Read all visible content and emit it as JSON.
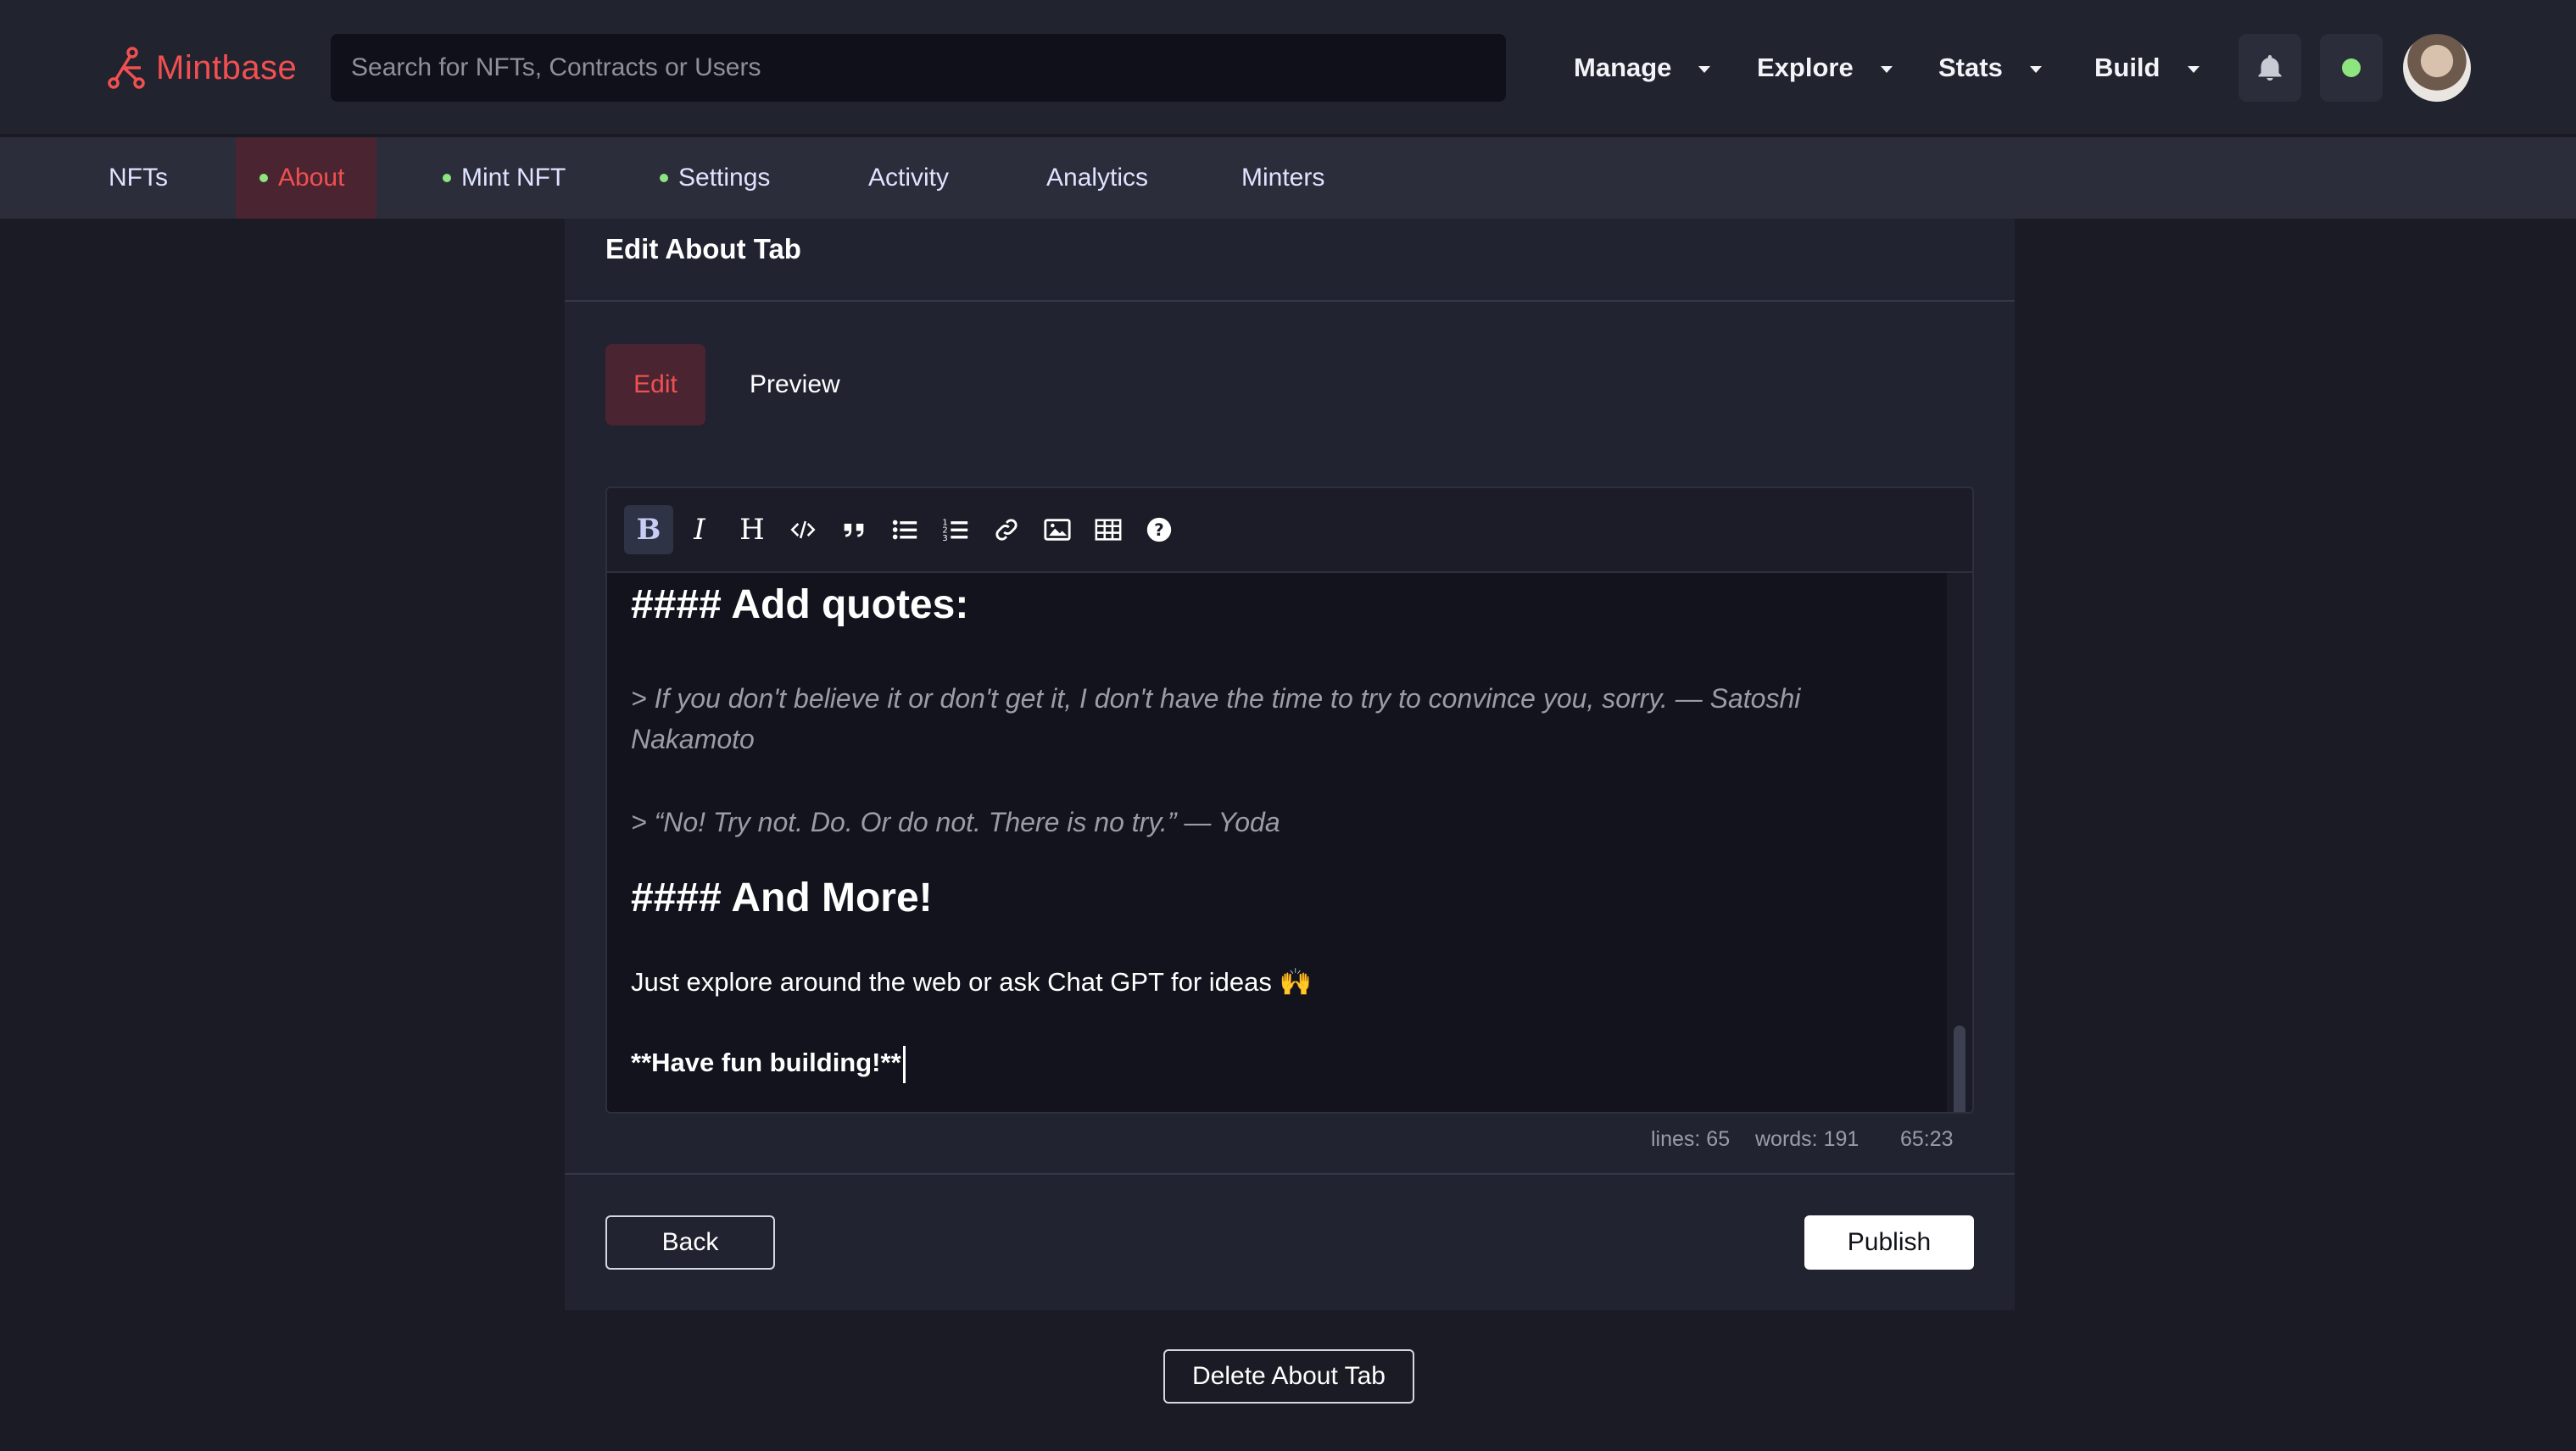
{
  "brand": {
    "name": "Mintbase",
    "color": "#f25050"
  },
  "search": {
    "placeholder": "Search for NFTs, Contracts or Users",
    "value": ""
  },
  "nav": {
    "menus": [
      {
        "label": "Manage"
      },
      {
        "label": "Explore"
      },
      {
        "label": "Stats"
      },
      {
        "label": "Build"
      }
    ],
    "icons": {
      "notifications": "bell-icon",
      "status": "green-dot",
      "avatar": "user-avatar"
    }
  },
  "subnav": {
    "tabs": [
      {
        "label": "NFTs",
        "dot": false,
        "active": false
      },
      {
        "label": "About",
        "dot": true,
        "active": true
      },
      {
        "label": "Mint NFT",
        "dot": true,
        "active": false
      },
      {
        "label": "Settings",
        "dot": true,
        "active": false
      },
      {
        "label": "Activity",
        "dot": false,
        "active": false
      },
      {
        "label": "Analytics",
        "dot": false,
        "active": false
      },
      {
        "label": "Minters",
        "dot": false,
        "active": false
      }
    ]
  },
  "panel": {
    "title": "Edit About Tab",
    "tabs": {
      "edit": "Edit",
      "preview": "Preview",
      "active": "Edit"
    }
  },
  "toolbar": {
    "tools": [
      "bold-icon",
      "italic-icon",
      "heading-icon",
      "code-icon",
      "quote-icon",
      "bullet-list-icon",
      "numbered-list-icon",
      "link-icon",
      "image-icon",
      "table-icon",
      "help-icon"
    ],
    "active": "bold-icon"
  },
  "editor": {
    "lines": {
      "heading1": "#### Add quotes:",
      "quote1a": "> If you don't believe it or don't get it, I don't have the time to try to convince you, sorry. — Satoshi",
      "quote1b": "Nakamoto",
      "quote2": "> “No! Try not. Do. Or do not. There is no try.” — Yoda",
      "heading2": "#### And More!",
      "para": "Just explore around the web or ask Chat GPT for ideas 🙌",
      "bold": "**Have fun building!**"
    },
    "status": {
      "lines": "lines: 65",
      "words": "words: 191",
      "cursor": "65:23"
    }
  },
  "actions": {
    "back": "Back",
    "publish": "Publish",
    "delete": "Delete About Tab"
  },
  "colors": {
    "background": "#1a1b25",
    "panel": "#212330",
    "accent": "#f25050",
    "online": "#8ee57f"
  }
}
